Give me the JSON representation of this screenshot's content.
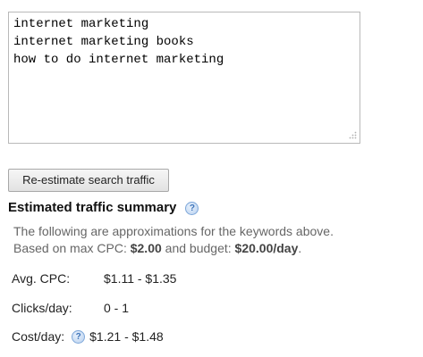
{
  "keywords": {
    "lines": [
      "internet marketing",
      "internet marketing books",
      "how to do internet marketing"
    ]
  },
  "reestimate_button": {
    "label": "Re-estimate search traffic"
  },
  "summary": {
    "title": "Estimated traffic summary",
    "help_icon": "question-mark-icon",
    "approx_line1": "The following are approximations for the keywords above.",
    "approx_line2_prefix": "Based on max CPC: ",
    "max_cpc": "$2.00",
    "approx_line2_middle": " and budget: ",
    "budget": "$20.00/day",
    "approx_line2_suffix": "."
  },
  "stats": {
    "avg_cpc": {
      "label": "Avg. CPC:",
      "value": "$1.11 - $1.35"
    },
    "clicks_per_day": {
      "label": "Clicks/day:",
      "value": "0 - 1"
    },
    "cost_per_day": {
      "label": "Cost/day:",
      "value": "$1.21 - $1.48"
    }
  },
  "colors": {
    "help_icon": "#3d73b9",
    "muted_text": "#666666"
  }
}
